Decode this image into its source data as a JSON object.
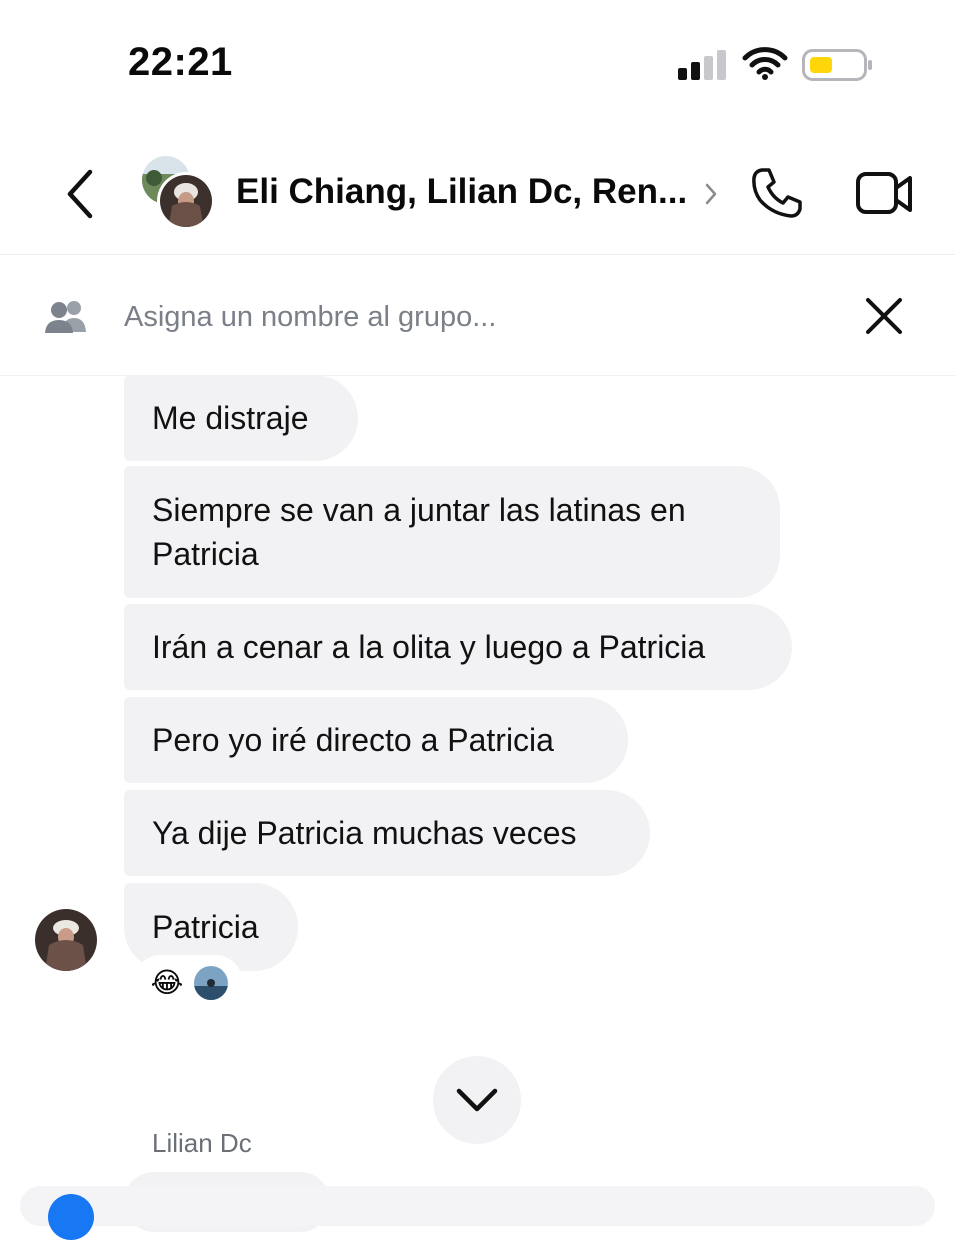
{
  "status_bar": {
    "time": "22:21",
    "battery_color": "#ffd60a"
  },
  "header": {
    "title": "Eli Chiang, Lilian Dc, Ren...",
    "back_icon": "chevron-left-icon",
    "call_icon": "phone-icon",
    "video_icon": "video-camera-icon"
  },
  "group_name": {
    "placeholder": "Asigna un nombre al grupo...",
    "icon": "people-icon",
    "close_icon": "close-icon"
  },
  "messages": [
    {
      "text": "Me distraje"
    },
    {
      "text": "Siempre se van a juntar las latinas en Patricia"
    },
    {
      "text": "Irán a cenar a la olita y luego a Patricia"
    },
    {
      "text": "Pero yo iré directo a Patricia"
    },
    {
      "text": "Ya dije Patricia muchas veces"
    },
    {
      "text": "Patricia",
      "reactions": [
        "😂"
      ]
    }
  ],
  "next_sender": {
    "name": "Lilian Dc"
  },
  "colors": {
    "bubble_bg": "#f2f2f4",
    "accent": "#1877f2"
  }
}
